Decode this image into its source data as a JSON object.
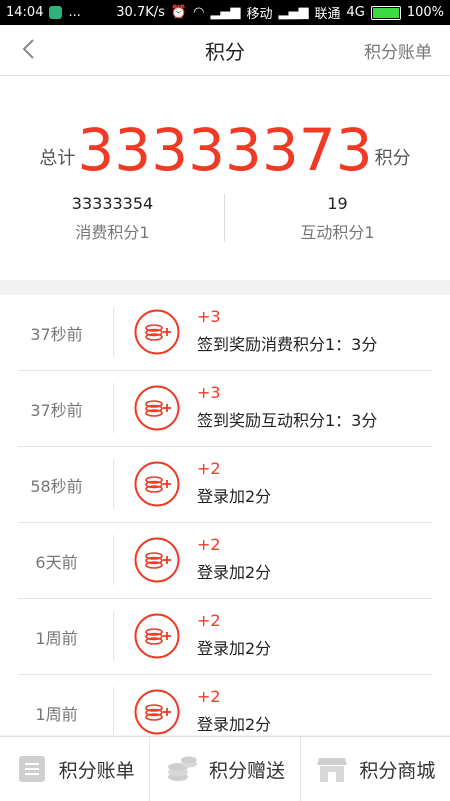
{
  "status_bar": {
    "time": "14:04",
    "speed": "30.7K/s",
    "carrier1": "移动",
    "carrier2": "联通",
    "network": "4G",
    "battery": "100%",
    "dots": "..."
  },
  "header": {
    "title": "积分",
    "right_link": "积分账单"
  },
  "summary": {
    "total_prefix": "总计",
    "total_value": "33333373",
    "total_suffix": "积分",
    "consume_value": "33333354",
    "consume_label": "消费积分1",
    "interact_value": "19",
    "interact_label": "互动积分1"
  },
  "records": [
    {
      "time": "37秒前",
      "delta": "+3",
      "desc": "签到奖励消费积分1：3分"
    },
    {
      "time": "37秒前",
      "delta": "+3",
      "desc": "签到奖励互动积分1：3分"
    },
    {
      "time": "58秒前",
      "delta": "+2",
      "desc": "登录加2分"
    },
    {
      "time": "6天前",
      "delta": "+2",
      "desc": "登录加2分"
    },
    {
      "time": "1周前",
      "delta": "+2",
      "desc": "登录加2分"
    },
    {
      "time": "1周前",
      "delta": "+2",
      "desc": "登录加2分"
    }
  ],
  "tabs": [
    {
      "label": "积分账单",
      "icon": "list-icon"
    },
    {
      "label": "积分赠送",
      "icon": "coins-icon"
    },
    {
      "label": "积分商城",
      "icon": "store-icon"
    }
  ],
  "colors": {
    "accent": "#f03a24"
  }
}
